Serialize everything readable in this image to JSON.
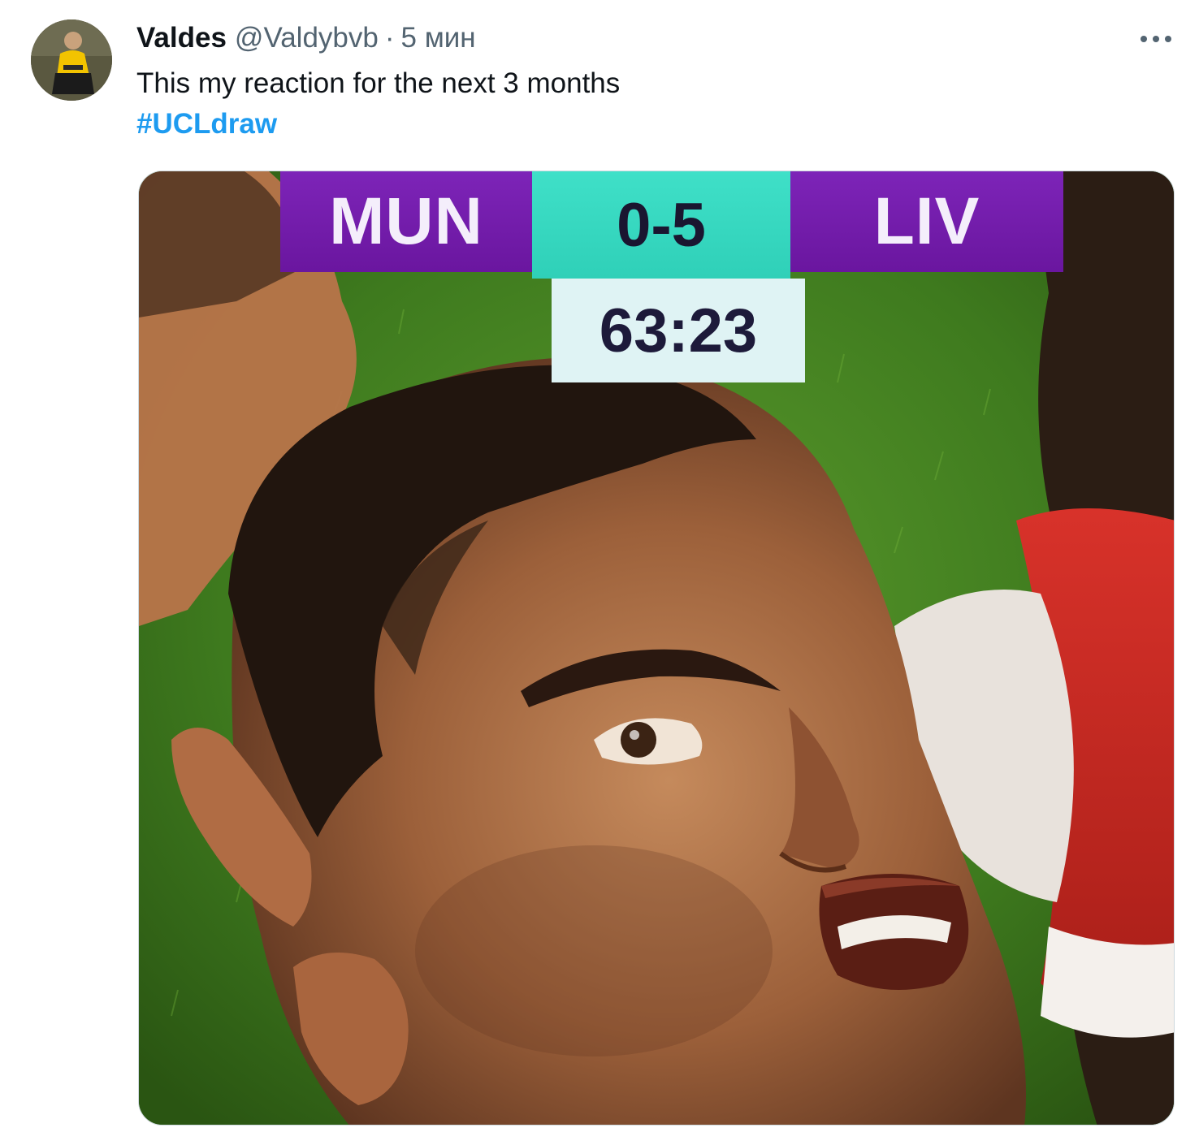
{
  "tweet": {
    "author": {
      "display_name": "Valdes",
      "handle": "@Valdybvb"
    },
    "separator": "·",
    "timestamp": "5 мин",
    "more_label": "•••",
    "text": "This my reaction for the next 3 months",
    "hashtag": "#UCLdraw",
    "colors": {
      "hashtag": "#1d9bf0",
      "secondary_text": "#536471",
      "primary_text": "#0f1419"
    },
    "media": {
      "scoreboard": {
        "home": "MUN",
        "score": "0-5",
        "away": "LIV",
        "clock": "63:23"
      },
      "colors": {
        "scoreboard_team_bg": "#7d24b8",
        "scoreboard_score_bg": "#3fe0c8",
        "scoreboard_clock_bg": "#dff3f4"
      }
    }
  }
}
